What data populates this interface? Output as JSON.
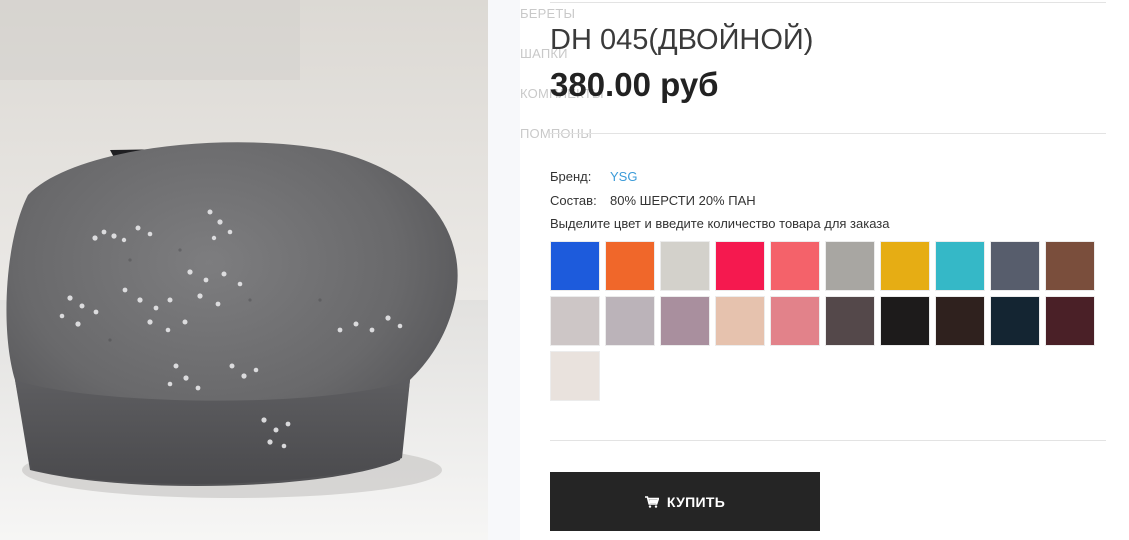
{
  "menu": {
    "items": [
      {
        "label": "БЕРЕТЫ"
      },
      {
        "label": "ШАПКИ"
      },
      {
        "label": "КОМПЛЕКТЫ"
      },
      {
        "label": "ПОМПОНЫ"
      }
    ]
  },
  "product": {
    "title": "DH 045(ДВОЙНОЙ)",
    "price": "380.00 руб",
    "brand_label": "Бренд:",
    "brand_value": "YSG",
    "composition_label": "Состав:",
    "composition_value": "80% ШЕРСТИ 20% ПАН",
    "instruction": "Выделите цвет и введите количество товара для заказа"
  },
  "swatches": [
    "#1d5bdc",
    "#f0672a",
    "#d3d1cb",
    "#f5194f",
    "#f4626a",
    "#a8a6a2",
    "#e6ad14",
    "#35b8c7",
    "#575d6c",
    "#7a4e3c",
    "#cdc6c6",
    "#bbb3b9",
    "#a98f9e",
    "#e6c2ae",
    "#e2828a",
    "#54484a",
    "#1d1b1b",
    "#2f211e",
    "#142532",
    "#4a2027",
    "#e9e2dd"
  ],
  "actions": {
    "buy_label": "КУПИТЬ",
    "cart_icon": "cart-icon"
  },
  "colors": {
    "button_bg": "#252525",
    "link": "#3b9bd8"
  }
}
